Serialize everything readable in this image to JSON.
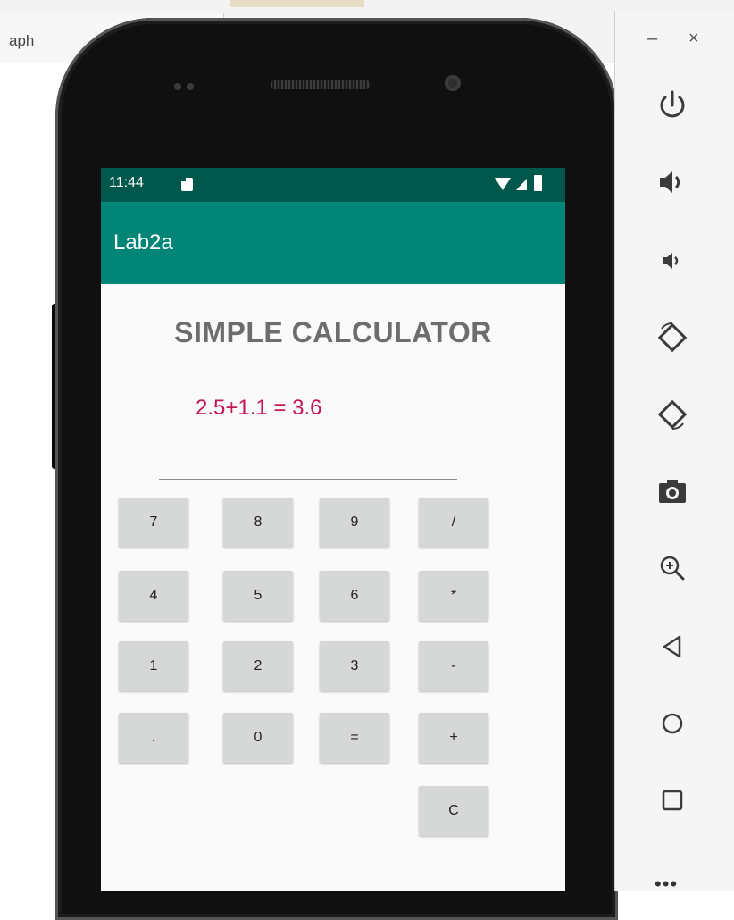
{
  "host_window": {
    "tab_label": "aph"
  },
  "phone": {
    "status_bar": {
      "time": "11:44"
    },
    "app_bar": {
      "title": "Lab2a"
    },
    "calculator": {
      "title": "SIMPLE CALCULATOR",
      "result_text": "2.5+1.1 = 3.6",
      "input_value": "",
      "keys": {
        "k7": "7",
        "k8": "8",
        "k9": "9",
        "div": "/",
        "k4": "4",
        "k5": "5",
        "k6": "6",
        "mul": "*",
        "k1": "1",
        "k2": "2",
        "k3": "3",
        "sub": "-",
        "dot": ".",
        "k0": "0",
        "eq": "=",
        "add": "+",
        "clear": "C"
      }
    }
  },
  "emulator_toolbar": {
    "minimize": "–",
    "close": "×",
    "tools": [
      "power-icon",
      "volume-up-icon",
      "volume-down-icon",
      "rotate-left-icon",
      "rotate-right-icon",
      "camera-icon",
      "zoom-icon",
      "back-icon",
      "home-icon",
      "overview-icon"
    ],
    "more": "•••"
  },
  "colors": {
    "status_bar": "#00574b",
    "app_bar": "#008577",
    "result_text": "#c2185b",
    "key_bg": "#d6d7d7"
  }
}
